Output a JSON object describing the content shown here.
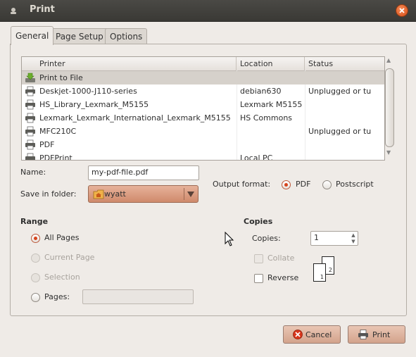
{
  "window": {
    "title": "Print"
  },
  "tabs": [
    {
      "label": "General",
      "active": true
    },
    {
      "label": "Page Setup",
      "active": false
    },
    {
      "label": "Options",
      "active": false
    }
  ],
  "printer_list": {
    "columns": [
      "Printer",
      "Location",
      "Status"
    ],
    "rows": [
      {
        "name": "Print to File",
        "location": "",
        "status": "",
        "icon": "file-printer-icon",
        "selected": true
      },
      {
        "name": "Deskjet-1000-J110-series",
        "location": "debian630",
        "status": "Unplugged or tu",
        "icon": "printer-icon"
      },
      {
        "name": "HS_Library_Lexmark_M5155",
        "location": "Lexmark M5155",
        "status": "",
        "icon": "printer-icon"
      },
      {
        "name": "Lexmark_Lexmark_International_Lexmark_M5155",
        "location": "HS Commons",
        "status": "",
        "icon": "printer-icon"
      },
      {
        "name": "MFC210C",
        "location": "",
        "status": "Unplugged or tu",
        "icon": "printer-icon"
      },
      {
        "name": "PDF",
        "location": "",
        "status": "",
        "icon": "printer-icon"
      },
      {
        "name": "PDFPrint",
        "location": "Local PC",
        "status": "",
        "icon": "printer-icon"
      }
    ]
  },
  "file": {
    "name_label": "Name:",
    "name_value": "my-pdf-file.pdf",
    "folder_label": "Save in folder:",
    "folder_value": "wyatt",
    "format_label": "Output format:",
    "format_options": [
      "PDF",
      "Postscript"
    ],
    "format_selected": "PDF"
  },
  "range": {
    "heading": "Range",
    "all_pages": "All Pages",
    "current_page": "Current Page",
    "selection": "Selection",
    "pages": "Pages:",
    "pages_value": "",
    "selected": "All Pages"
  },
  "copies": {
    "heading": "Copies",
    "copies_label": "Copies:",
    "copies_value": "1",
    "collate": "Collate",
    "reverse": "Reverse",
    "page_numbers": [
      "1",
      "2"
    ]
  },
  "buttons": {
    "cancel": "Cancel",
    "print": "Print"
  },
  "colors": {
    "accent": "#d6431c",
    "titlebar": "#3f3e3a",
    "button": "#dcb09b"
  }
}
